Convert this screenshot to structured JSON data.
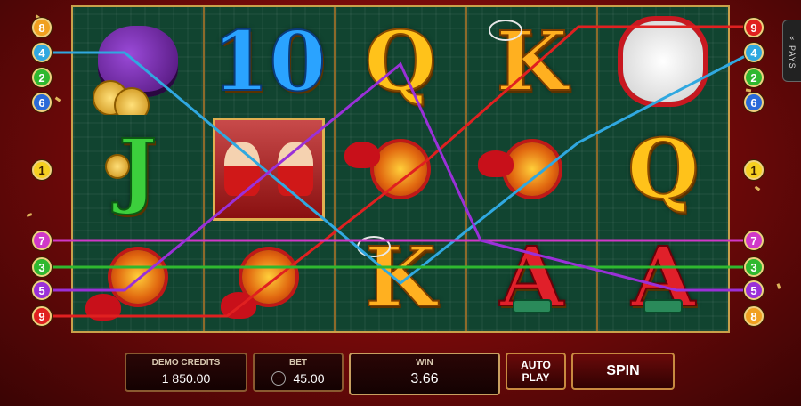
{
  "pays_tab": {
    "chevron": "«",
    "label": "PAYS"
  },
  "reels": [
    [
      {
        "sym": "pouch-coins"
      },
      {
        "sym": "J",
        "color": "green"
      },
      {
        "sym": "lantern-knot"
      }
    ],
    [
      {
        "sym": "10",
        "color": "blue"
      },
      {
        "sym": "twin-kids"
      },
      {
        "sym": "lantern-knot"
      }
    ],
    [
      {
        "sym": "Q",
        "color": "gold"
      },
      {
        "sym": "lantern-knot"
      },
      {
        "sym": "K",
        "color": "gold-k"
      }
    ],
    [
      {
        "sym": "K",
        "color": "gold-k"
      },
      {
        "sym": "lantern-knot"
      },
      {
        "sym": "A",
        "color": "red"
      }
    ],
    [
      {
        "sym": "lucky-cat"
      },
      {
        "sym": "Q",
        "color": "gold"
      },
      {
        "sym": "A",
        "color": "red"
      }
    ]
  ],
  "paylines": [
    {
      "number": "1",
      "color": "#f5d020"
    },
    {
      "number": "2",
      "color": "#2fb82f"
    },
    {
      "number": "3",
      "color": "#2fb82f"
    },
    {
      "number": "4",
      "color": "#30a8e0"
    },
    {
      "number": "5",
      "color": "#9a30d8"
    },
    {
      "number": "6",
      "color": "#2a6ad8"
    },
    {
      "number": "7",
      "color": "#d038c8"
    },
    {
      "number": "8",
      "color": "#f0a020"
    },
    {
      "number": "9",
      "color": "#e02020"
    }
  ],
  "left_markers": [
    "8",
    "4",
    "2",
    "6",
    "1",
    "7",
    "3",
    "5",
    "9"
  ],
  "right_markers": [
    "9",
    "4",
    "2",
    "6",
    "1",
    "7",
    "3",
    "5",
    "8"
  ],
  "controls": {
    "credits_label": "DEMO CREDITS",
    "credits_value": "1 850.00",
    "bet_label": "BET",
    "bet_value": "45.00",
    "bet_minus": "−",
    "win_label": "WIN",
    "win_value": "3.66",
    "autoplay_label": "AUTO PLAY",
    "spin_label": "SPIN"
  },
  "colors": {
    "frame": "#c8a04a",
    "reel_bg": "#114430"
  }
}
